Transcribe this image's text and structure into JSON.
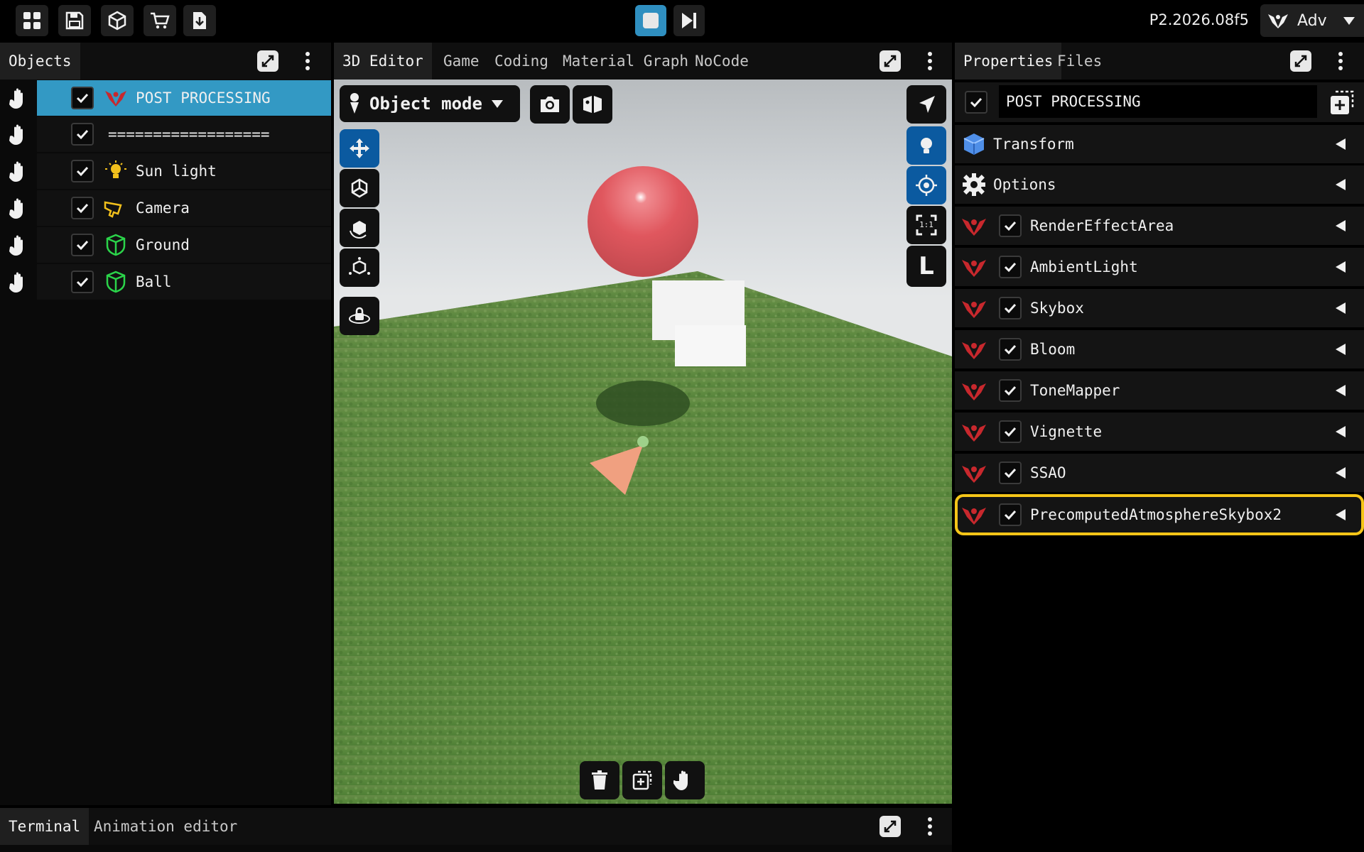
{
  "app": {
    "version": "P2.2026.08f5",
    "mode_label": "Adv"
  },
  "colors": {
    "selection": "#3399c4",
    "accent_blue": "#0b5aa0",
    "highlight": "#f5c518",
    "post_icon": "#c8282d",
    "ground_icon": "#2bd44a",
    "light_icon": "#f2c01c"
  },
  "toolbar": {
    "left_icons": [
      "grid-icon",
      "save-icon",
      "cube-icon",
      "cart-icon",
      "download-icon"
    ],
    "center_icons": [
      "stop-icon",
      "step-forward-icon"
    ]
  },
  "objects_panel": {
    "tab": "Objects",
    "items": [
      {
        "label": "POST PROCESSING",
        "icon": "post-processing-icon",
        "selected": true
      },
      {
        "label": "==================",
        "icon": "",
        "selected": false
      },
      {
        "label": "Sun light",
        "icon": "light-bulb-icon",
        "selected": false
      },
      {
        "label": "Camera",
        "icon": "camera-icon",
        "selected": false
      },
      {
        "label": "Ground",
        "icon": "mesh-icon",
        "selected": false
      },
      {
        "label": "Ball",
        "icon": "mesh-icon",
        "selected": false
      }
    ]
  },
  "editor": {
    "tabs": [
      "3D Editor",
      "Game",
      "Coding",
      "Material Graph",
      "NoCode"
    ],
    "mode_dropdown": "Object mode",
    "left_tools": [
      "move-icon",
      "scale-icon",
      "rotate-icon",
      "transform-icon",
      "orbit-lock-icon"
    ],
    "right_tools": [
      "select-cursor-icon",
      "light-toggle-icon",
      "target-icon",
      "fit-view-icon",
      "local-icon"
    ],
    "right_label": "L",
    "fit_label": "1:1",
    "bottom_tools": [
      "trash-icon",
      "duplicate-icon",
      "hand-icon"
    ]
  },
  "properties_panel": {
    "tabs": [
      "Properties",
      "Files"
    ],
    "name_value": "POST PROCESSING",
    "sections": [
      {
        "label": "Transform",
        "icon": "cube-blue-icon"
      },
      {
        "label": "Options",
        "icon": "gear-icon"
      }
    ],
    "effects": [
      {
        "label": "RenderEffectArea"
      },
      {
        "label": "AmbientLight"
      },
      {
        "label": "Skybox"
      },
      {
        "label": "Bloom"
      },
      {
        "label": "ToneMapper"
      },
      {
        "label": "Vignette"
      },
      {
        "label": "SSAO"
      },
      {
        "label": "PrecomputedAtmosphereSkybox2",
        "highlighted": true
      }
    ]
  },
  "bottom_panel": {
    "tabs": [
      "Terminal",
      "Animation editor"
    ]
  }
}
